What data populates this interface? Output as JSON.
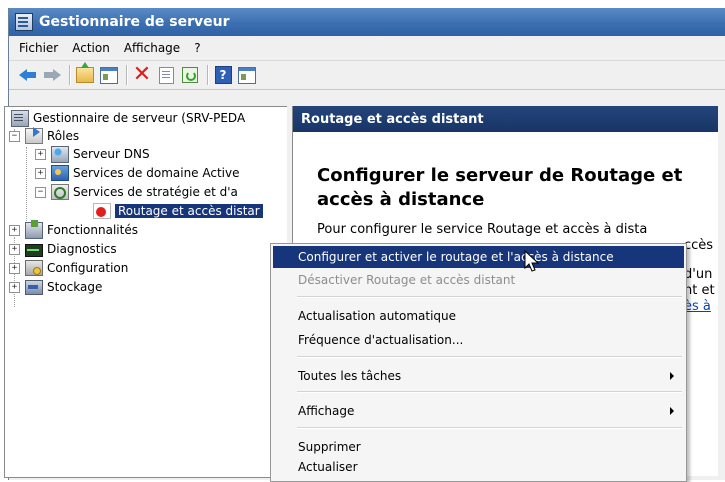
{
  "window": {
    "title": "Gestionnaire de serveur"
  },
  "menubar": {
    "items": [
      "Fichier",
      "Action",
      "Affichage",
      "?"
    ]
  },
  "toolbar": {
    "icons": [
      "back-icon",
      "forward-icon",
      "up-folder-icon",
      "show-hide-tree-icon",
      "delete-icon",
      "properties-icon",
      "refresh-icon",
      "help-icon",
      "show-hide-action-pane-icon"
    ]
  },
  "tree": {
    "root": "Gestionnaire de serveur (SRV-PEDA",
    "roles": "Rôles",
    "dns": "Serveur DNS",
    "ad": "Services de domaine Active",
    "nps": "Services de stratégie et d'a",
    "rras": "Routage et accès distar",
    "features": "Fonctionnalités",
    "diagnostics": "Diagnostics",
    "configuration": "Configuration",
    "storage": "Stockage",
    "expander_plus": "+",
    "expander_minus": "−"
  },
  "content": {
    "header": "Routage et accès distant",
    "title_line1": "Configurer le serveur de Routage et",
    "title_line2": "accès à distance",
    "text1": "Pour configurer le service Routage et accès à dista",
    "text2": "ccès",
    "text3": "d'un",
    "text4": "nt et",
    "link": "ès à"
  },
  "context_menu": {
    "configure": "Configurer et activer le routage et l'accès à distance",
    "disable": "Désactiver Routage et accès distant",
    "auto_refresh": "Actualisation automatique",
    "refresh_frequency": "Fréquence d'actualisation...",
    "all_tasks": "Toutes les tâches",
    "view": "Affichage",
    "delete": "Supprimer",
    "refresh": "Actualiser"
  },
  "colors": {
    "selection": "#16357a",
    "header": "#1f3f73",
    "titlebar": "#3c6fb0"
  }
}
